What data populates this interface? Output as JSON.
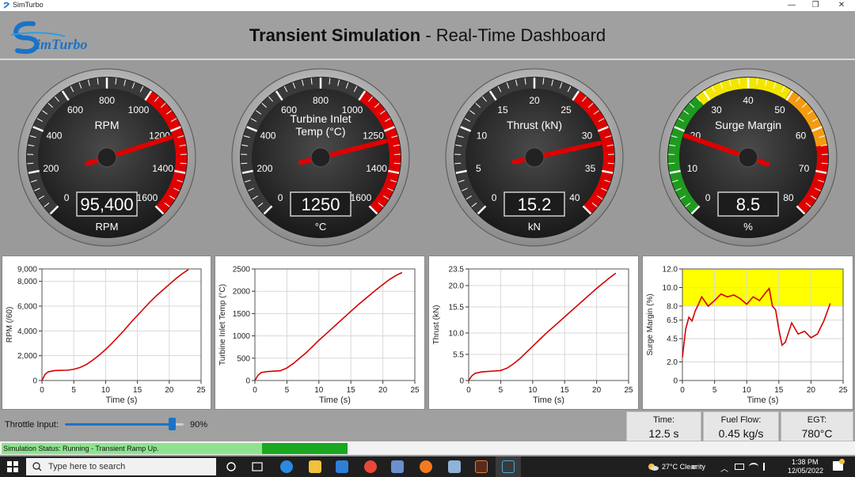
{
  "window": {
    "app_title": "SimTurbo",
    "minimize": "—",
    "restore": "❐",
    "close": "✕"
  },
  "header": {
    "title_bold": "Transient Simulation",
    "title_rest": " - Real-Time Dashboard",
    "logo_text": "imTurbo"
  },
  "gauges": [
    {
      "label": "RPM",
      "ticks": [
        "0",
        "200",
        "400",
        "600",
        "800",
        "1000",
        "1200",
        "1400",
        "1600"
      ],
      "readout": "95,400",
      "unit": "RPM",
      "needle_value": 1230,
      "min": 0,
      "max": 1600,
      "red_from": 1000
    },
    {
      "label_line1": "Turbine Inlet",
      "label_line2": "Temp (°C)",
      "ticks": [
        "0",
        "200",
        "400",
        "600",
        "800",
        "1000",
        "1250",
        "1400",
        "1600"
      ],
      "readout": "1250",
      "unit": "°C",
      "needle_value": 1250,
      "min": 0,
      "max": 1600,
      "red_from": 1000
    },
    {
      "label": "Thrust (kN)",
      "ticks": [
        "0",
        "5",
        "10",
        "15",
        "20",
        "25",
        "30",
        "35",
        "40"
      ],
      "readout": "15.2",
      "unit": "kN",
      "needle_value": 31.5,
      "min": 0,
      "max": 40,
      "red_from": 25
    },
    {
      "label": "Surge Margin",
      "ticks": [
        "0",
        "10",
        "20",
        "30",
        "40",
        "50",
        "60",
        "70",
        "80"
      ],
      "readout": "8.5",
      "unit": "%",
      "needle_value": 19,
      "min": 0,
      "max": 80,
      "zones": [
        "#1f9a1f",
        "#f2e600",
        "#f39c12",
        "#e00000"
      ]
    }
  ],
  "chart_data": [
    {
      "type": "line",
      "title": "",
      "xlabel": "Time (s)",
      "ylabel": "RPM (/60)",
      "xlim": [
        0,
        25
      ],
      "ylim": [
        0,
        9000
      ],
      "x_ticks": [
        "0",
        "5",
        "10",
        "15",
        "20",
        "25"
      ],
      "y_ticks": [
        "0",
        "2,000",
        "4,000",
        "6,000",
        "8,000",
        "9,000"
      ],
      "series": [
        {
          "x": [
            0,
            0.5,
            1,
            2,
            3,
            4,
            5,
            6,
            7,
            8,
            9,
            10,
            11,
            12,
            13,
            14,
            15,
            16,
            17,
            18,
            19,
            20,
            21,
            22,
            23
          ],
          "y": [
            0,
            500,
            700,
            800,
            820,
            830,
            900,
            1050,
            1300,
            1650,
            2050,
            2500,
            3000,
            3550,
            4100,
            4700,
            5250,
            5800,
            6350,
            6850,
            7300,
            7750,
            8200,
            8600,
            8950
          ]
        }
      ]
    },
    {
      "type": "line",
      "title": "",
      "xlabel": "Time (s)",
      "ylabel": "Turbine Inlet Temp (°C)",
      "xlim": [
        0,
        25
      ],
      "ylim": [
        0,
        2500
      ],
      "x_ticks": [
        "0",
        "5",
        "10",
        "15",
        "20",
        "25"
      ],
      "y_ticks": [
        "0",
        "500",
        "1000",
        "1500",
        "2000",
        "2500"
      ],
      "series": [
        {
          "x": [
            0,
            0.5,
            1,
            2,
            3,
            4,
            5,
            6,
            7,
            8,
            9,
            10,
            11,
            12,
            13,
            14,
            15,
            16,
            17,
            18,
            19,
            20,
            21,
            22,
            23
          ],
          "y": [
            0,
            120,
            180,
            200,
            210,
            220,
            280,
            380,
            500,
            620,
            760,
            900,
            1030,
            1160,
            1290,
            1420,
            1550,
            1680,
            1800,
            1920,
            2040,
            2150,
            2260,
            2350,
            2420
          ]
        }
      ]
    },
    {
      "type": "line",
      "title": "",
      "xlabel": "Time (s)",
      "ylabel": "Thrust (kN)",
      "xlim": [
        0,
        25
      ],
      "ylim": [
        0,
        23.5
      ],
      "x_ticks": [
        "0",
        "5",
        "10",
        "15",
        "20",
        "25"
      ],
      "y_ticks": [
        "0",
        "5.5",
        "10.0",
        "15.5",
        "20.0",
        "23.5"
      ],
      "series": [
        {
          "x": [
            0,
            0.5,
            1,
            2,
            3,
            4,
            5,
            6,
            7,
            8,
            9,
            10,
            11,
            12,
            13,
            14,
            15,
            16,
            17,
            18,
            19,
            20,
            21,
            22,
            23
          ],
          "y": [
            0,
            1.0,
            1.5,
            1.8,
            1.9,
            2.0,
            2.1,
            2.6,
            3.5,
            4.6,
            5.9,
            7.2,
            8.5,
            9.8,
            11.0,
            12.2,
            13.4,
            14.6,
            15.8,
            17.0,
            18.2,
            19.4,
            20.5,
            21.6,
            22.6
          ]
        }
      ]
    },
    {
      "type": "line",
      "title": "",
      "xlabel": "Time (s)",
      "ylabel": "Surge Margin (%)",
      "xlim": [
        0,
        25
      ],
      "ylim": [
        0,
        12
      ],
      "x_ticks": [
        "0",
        "5",
        "10",
        "15",
        "20",
        "25"
      ],
      "y_ticks": [
        "0",
        "2.0",
        "4.5",
        "6.5",
        "8.0",
        "10.0",
        "12.0"
      ],
      "band": {
        "from": 8.0,
        "to": 12.0,
        "color": "#ffff00"
      },
      "series": [
        {
          "x": [
            0,
            0.5,
            1,
            1.5,
            2,
            2.5,
            3,
            3.5,
            4,
            5,
            6,
            7,
            8,
            9,
            10,
            11,
            12,
            13,
            13.5,
            14,
            14.5,
            15,
            15.5,
            16,
            17,
            18,
            19,
            20,
            21,
            22,
            23
          ],
          "y": [
            2.5,
            5.5,
            6.8,
            6.4,
            7.5,
            8.2,
            9.0,
            8.5,
            8.0,
            8.6,
            9.3,
            9.0,
            9.2,
            8.8,
            8.2,
            9.0,
            8.6,
            9.5,
            9.9,
            8.0,
            7.6,
            5.5,
            3.8,
            4.1,
            6.2,
            5.0,
            5.3,
            4.6,
            5.0,
            6.4,
            8.3
          ]
        }
      ]
    }
  ],
  "controls": {
    "throttle_label": "Throttle Input:",
    "throttle_value": "90%",
    "throttle_level": 0.9
  },
  "stats": [
    {
      "label": "Time:",
      "value": "12.5 s"
    },
    {
      "label": "Fuel Flow:",
      "value": "0.45 kg/s"
    },
    {
      "label": "EGT:",
      "value": "780°C"
    }
  ],
  "status": {
    "text": "Simulation Status: Running - Transient Ramp Up.",
    "progress": 0.1
  },
  "taskbar": {
    "search_placeholder": "Type here to search",
    "weather": "27°C Clear",
    "weather_extra": "erity",
    "time": "1:38 PM",
    "date": "12/05/2022"
  },
  "colors": {
    "needle": "#e00000",
    "line": "#d40000",
    "bg": "#9a9a9a"
  }
}
